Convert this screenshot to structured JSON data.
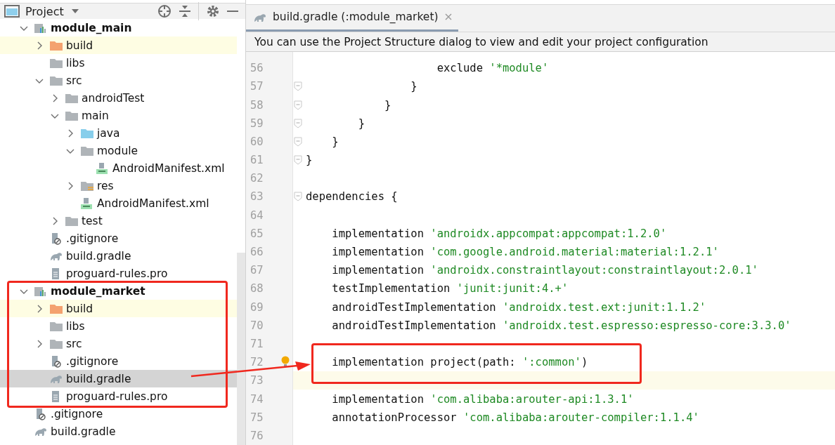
{
  "sidebar": {
    "title": "Project",
    "tree": [
      {
        "name": "module_main",
        "kind": "module",
        "expanded": true,
        "selected": false,
        "children": [
          {
            "name": "build",
            "kind": "build_folder",
            "expanded": false,
            "selected": false
          },
          {
            "name": "libs",
            "kind": "folder",
            "selected": false
          },
          {
            "name": "src",
            "kind": "folder",
            "expanded": true,
            "selected": false,
            "children": [
              {
                "name": "androidTest",
                "kind": "folder",
                "expanded": false,
                "selected": false
              },
              {
                "name": "main",
                "kind": "folder",
                "expanded": true,
                "selected": false,
                "children": [
                  {
                    "name": "java",
                    "kind": "source_folder",
                    "expanded": false,
                    "selected": false
                  },
                  {
                    "name": "module",
                    "kind": "folder",
                    "expanded": true,
                    "selected": false,
                    "children": [
                      {
                        "name": "AndroidManifest.xml",
                        "kind": "manifest",
                        "selected": false
                      }
                    ]
                  },
                  {
                    "name": "res",
                    "kind": "res_folder",
                    "expanded": false,
                    "selected": false
                  },
                  {
                    "name": "AndroidManifest.xml",
                    "kind": "manifest",
                    "selected": false
                  }
                ]
              },
              {
                "name": "test",
                "kind": "folder",
                "expanded": false,
                "selected": false
              }
            ]
          },
          {
            "name": ".gitignore",
            "kind": "ignore_file",
            "selected": false
          },
          {
            "name": "build.gradle",
            "kind": "gradle",
            "selected": false
          },
          {
            "name": "proguard-rules.pro",
            "kind": "text_file",
            "selected": false
          }
        ]
      },
      {
        "name": "module_market",
        "kind": "module",
        "expanded": true,
        "selected": false,
        "children": [
          {
            "name": "build",
            "kind": "build_folder",
            "expanded": false,
            "selected": false
          },
          {
            "name": "libs",
            "kind": "folder",
            "selected": false
          },
          {
            "name": "src",
            "kind": "folder",
            "expanded": false,
            "selected": false
          },
          {
            "name": ".gitignore",
            "kind": "ignore_file",
            "selected": false
          },
          {
            "name": "build.gradle",
            "kind": "gradle",
            "selected": true
          },
          {
            "name": "proguard-rules.pro",
            "kind": "text_file",
            "selected": false
          }
        ]
      },
      {
        "name": ".gitignore",
        "kind": "ignore_file",
        "selected": false
      },
      {
        "name": "build.gradle",
        "kind": "gradle",
        "selected": false
      }
    ]
  },
  "editor": {
    "tabs": [
      {
        "label": "build.gradle (:module_market)",
        "selected": true
      }
    ],
    "banner": "You can use the Project Structure dialog to view and edit your project configuration",
    "lines": [
      {
        "number": "56",
        "code": "                    exclude ",
        "string": "'*module'"
      },
      {
        "number": "57",
        "code": "                }",
        "fold": true
      },
      {
        "number": "58",
        "code": "            }",
        "fold": true
      },
      {
        "number": "59",
        "code": "        }",
        "fold": true
      },
      {
        "number": "60",
        "code": "    }",
        "fold": true
      },
      {
        "number": "61",
        "code": "}",
        "fold": true
      },
      {
        "number": "62"
      },
      {
        "number": "63",
        "code": "dependencies {",
        "fold": true
      },
      {
        "number": "64"
      },
      {
        "number": "65",
        "code": "    implementation ",
        "string": "'androidx.appcompat:appcompat:1.2.0'"
      },
      {
        "number": "66",
        "code": "    implementation ",
        "string": "'com.google.android.material:material:1.2.1'"
      },
      {
        "number": "67",
        "code": "    implementation ",
        "string": "'androidx.constraintlayout:constraintlayout:2.0.1'"
      },
      {
        "number": "68",
        "code": "    testImplementation ",
        "string": "'junit:junit:4.+'"
      },
      {
        "number": "69",
        "code": "    androidTestImplementation ",
        "string": "'androidx.test.ext:junit:1.1.2'"
      },
      {
        "number": "70",
        "code": "    androidTestImplementation ",
        "string": "'androidx.test.espresso:espresso-core:3.3.0'"
      },
      {
        "number": "71"
      },
      {
        "number": "72",
        "code": "    implementation project(path: ",
        "string": "':common'",
        "after": ")",
        "bulb": true
      },
      {
        "number": "73",
        "current": true
      },
      {
        "number": "74",
        "code": "    implementation ",
        "string": "'com.alibaba:arouter-api:1.3.1'"
      },
      {
        "number": "75",
        "code": "    annotationProcessor ",
        "string": "'com.alibaba:arouter-compiler:1.1.4'"
      },
      {
        "number": "76"
      }
    ]
  }
}
